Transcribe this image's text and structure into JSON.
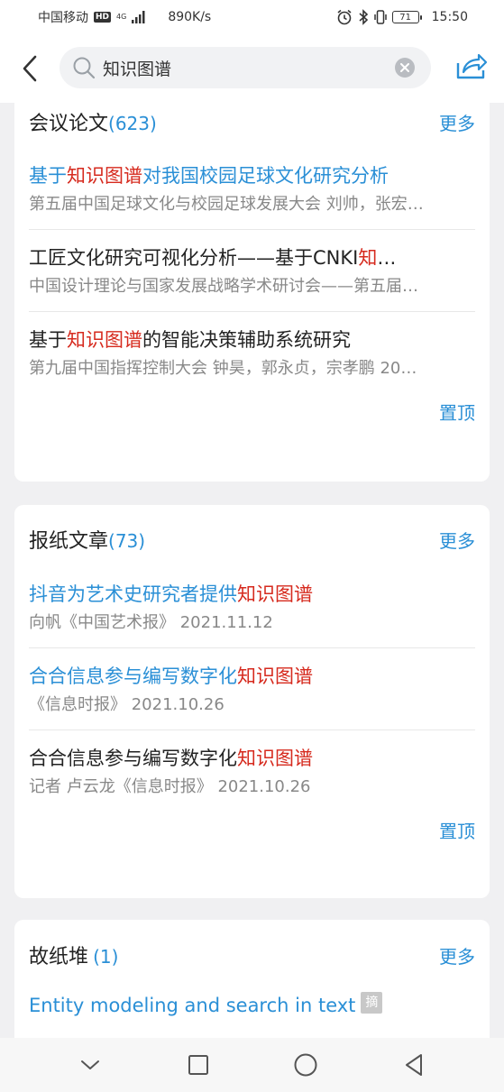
{
  "status_bar": {
    "carrier": "中国移动",
    "hd": "HD",
    "net_type": "4G",
    "speed": "890K/s",
    "battery": "71",
    "time": "15:50"
  },
  "search": {
    "query": "知识图谱",
    "icons": [
      "back-icon",
      "search-icon",
      "clear-icon",
      "share-icon"
    ]
  },
  "sections": {
    "conference": {
      "title": "会议论文",
      "count": "(623)",
      "more": "更多",
      "pin": "置顶",
      "items": [
        {
          "pre": "基于",
          "hl": "知识图谱",
          "post": "对我国校园足球文化研究分析",
          "meta": "第五届中国足球文化与校园足球发展大会  刘帅，张宏…"
        },
        {
          "pre": "工匠文化研究可视化分析——基于CNKI",
          "hl": "知",
          "post": "…",
          "meta": "中国设计理论与国家发展战略学术研讨会——第五届…"
        },
        {
          "pre": "基于",
          "hl": "知识图谱",
          "post": "的智能决策辅助系统研究",
          "meta": "第九届中国指挥控制大会  钟昊，郭永贞，宗孝鹏  20…"
        }
      ]
    },
    "newspaper": {
      "title": "报纸文章",
      "count": "(73)",
      "more": "更多",
      "pin": "置顶",
      "items": [
        {
          "pre": "抖音为艺术史研究者提供",
          "hl": "知识图谱",
          "post": "",
          "meta": "向帆《中国艺术报》 2021.11.12"
        },
        {
          "pre": "合合信息参与编写数字化",
          "hl": "知识图谱",
          "post": "",
          "meta": "《信息时报》 2021.10.26"
        },
        {
          "pre": "合合信息参与编写数字化",
          "hl": "知识图谱",
          "post": "",
          "meta": "记者 卢云龙《信息时报》 2021.10.26"
        }
      ]
    },
    "archive": {
      "title": "故纸堆",
      "count": "(1)",
      "more": "更多",
      "items": [
        {
          "title": "Entity modeling and search in text",
          "badge": "摘"
        }
      ]
    }
  },
  "colors": {
    "accent": "#2a8fd6",
    "highlight": "#d62a1e",
    "background": "#f0f0f2"
  },
  "navbar": {
    "icons": [
      "nav-back-icon",
      "nav-home-icon",
      "nav-recents-icon",
      "nav-collapse-icon"
    ]
  }
}
